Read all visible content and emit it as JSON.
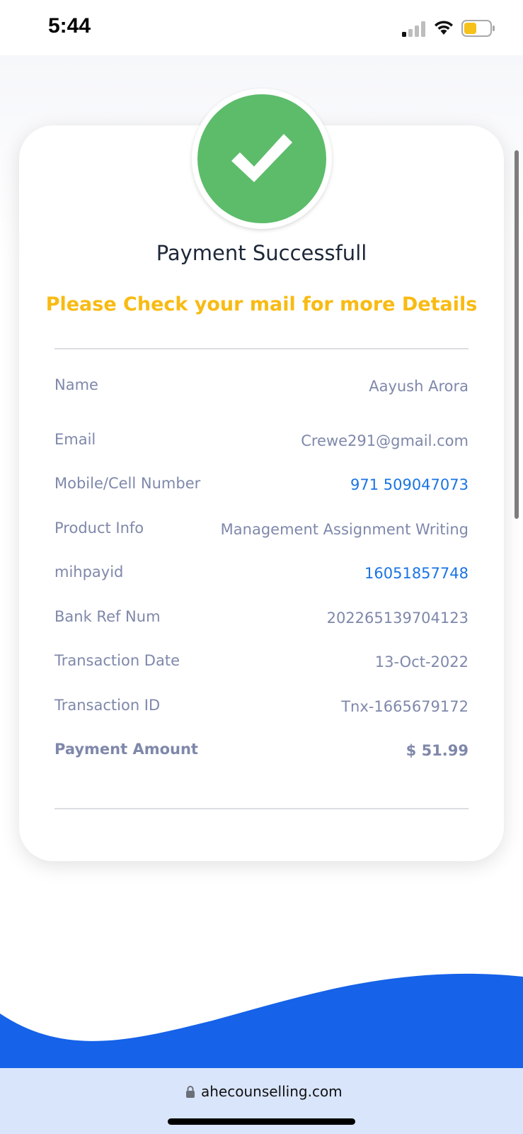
{
  "status_bar": {
    "time": "5:44"
  },
  "receipt": {
    "title": "Payment Successfull",
    "subtitle": "Please Check your mail for more Details",
    "rows": [
      {
        "label": "Name",
        "value": "Aayush Arora"
      },
      {
        "label": "Email",
        "value": "Crewe291@gmail.com"
      },
      {
        "label": "Mobile/Cell Number",
        "value": "971 509047073"
      },
      {
        "label": "Product Info",
        "value": "Management Assignment Writing"
      },
      {
        "label": "mihpayid",
        "value": "16051857748"
      },
      {
        "label": "Bank Ref Num",
        "value": "202265139704123"
      },
      {
        "label": "Transaction Date",
        "value": "13-Oct-2022"
      },
      {
        "label": "Transaction ID",
        "value": "Tnx-1665679172"
      },
      {
        "label": "Payment Amount",
        "value": "$ 51.99"
      }
    ]
  },
  "browser": {
    "url": "ahecounselling.com"
  },
  "colors": {
    "success_green": "#5cbc6a",
    "accent_yellow": "#f8bb13",
    "link_blue": "#1b74e4",
    "wave_blue": "#1662e8",
    "label_gray": "#7f88aa"
  },
  "icons": [
    "signal-icon",
    "wifi-icon",
    "battery-icon",
    "check-icon",
    "lock-icon"
  ]
}
